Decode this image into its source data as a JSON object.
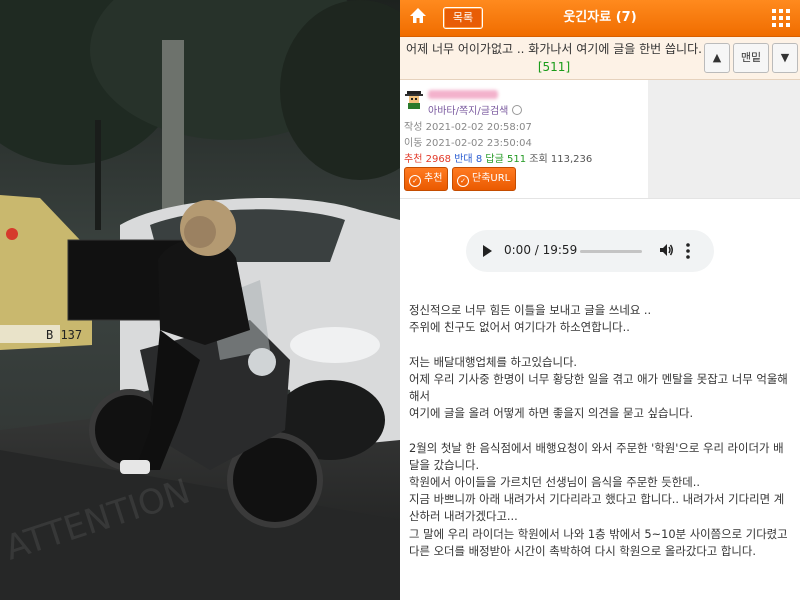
{
  "watermark": "ATTENTION",
  "license_plate": "B 137",
  "header": {
    "list_button": "목록",
    "board_title": "웃긴자료 (7)",
    "home_icon": "home-icon",
    "menu_icon": "grid-menu-icon"
  },
  "subject": {
    "title": "어제 너무 어이가없고 .. 화가나서 여기에 글을 한번 씁니다.",
    "comment_count": "[511]",
    "up_label": "▲",
    "top_label": "맨밑",
    "down_label": "▼"
  },
  "author": {
    "links": "아바타/쪽지/글검색",
    "written_label": "작성",
    "written": "2021-02-02 20:58:07",
    "modified_label": "이동",
    "modified": "2021-02-02 23:50:04",
    "recommend_label": "추천",
    "recommend": "2968",
    "oppose_label": "반대",
    "oppose": "8",
    "reply_label": "답글",
    "reply": "511",
    "views_label": "조회",
    "views": "113,236"
  },
  "actions": {
    "recommend": "추천",
    "short_url": "단축URL"
  },
  "audio": {
    "time": "0:00 / 19:59"
  },
  "post": {
    "lines": [
      "정신적으로 너무 힘든 이틀을 보내고 글을 쓰네요 ..",
      "주위에 친구도 없어서 여기다가 하소연합니다..",
      "",
      "저는 배달대행업체를 하고있습니다.",
      "어제 우리 기사중 한명이 너무 황당한 일을 겪고 애가 멘탈을 못잡고 너무 억울해 해서",
      "여기에 글을 올려 어떻게 하면 좋을지 의견을 묻고 싶습니다.",
      "",
      "2월의 첫날 한 음식점에서 배행요청이 와서 주문한 '학원'으로 우리 라이더가 배달을 갔습니다.",
      "학원에서 아이들을 가르치던 선생님이 음식을 주문한 듯한데..",
      "지금 바쁘니까 아래 내려가서 기다리라고 했다고 합니다.. 내려가서 기다리면 계산하러 내려가겠다고...",
      "그 말에 우리 라이더는 학원에서 나와 1층 밖에서 5~10분 사이쯤으로 기다렸고",
      "다른 오더를 배정받아 시간이 촉박하여 다시 학원으로 올라갔다고 합니다."
    ]
  },
  "colors": {
    "accent": "#f47a10",
    "recommend": "#e23b2a",
    "oppose": "#2a5cd1",
    "reply": "#229922"
  }
}
